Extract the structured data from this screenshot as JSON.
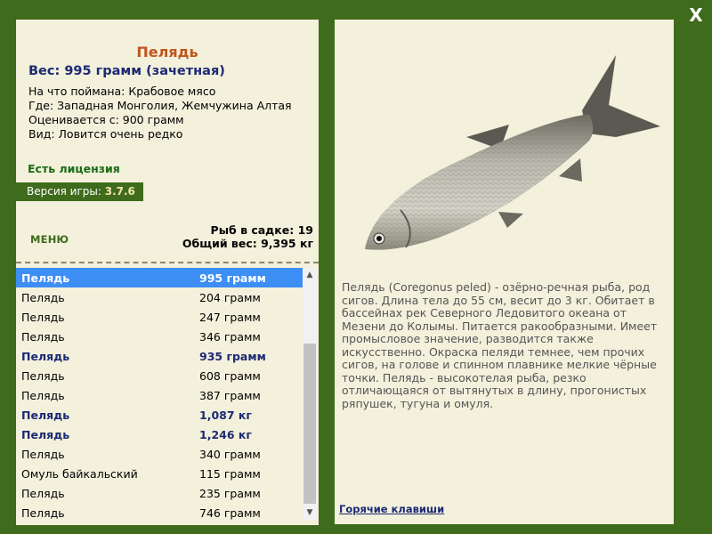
{
  "close_label": "X",
  "fish": {
    "title": "Пелядь",
    "weight": "Вес: 995 грамм (зачетная)",
    "bait": "На что поймана: Крабовое мясо",
    "place": "Где: Западная Монголия, Жемчужина Алтая",
    "value": "Оценивается с: 900 грамм",
    "rarity": "Вид: Ловится очень редко"
  },
  "license": "Есть лицензия",
  "version_label": "Версия игры:",
  "version_value": "3.7.6",
  "menu_label": "МЕНЮ",
  "stats": {
    "count": "Рыб в садке: 19",
    "total": "Общий вес: 9,395 кг"
  },
  "catch_list": [
    {
      "name": "Пелядь",
      "weight": "995 грамм",
      "style": "sel"
    },
    {
      "name": "Пелядь",
      "weight": "204 грамм",
      "style": ""
    },
    {
      "name": "Пелядь",
      "weight": "247 грамм",
      "style": ""
    },
    {
      "name": "Пелядь",
      "weight": "346 грамм",
      "style": ""
    },
    {
      "name": "Пелядь",
      "weight": "935 грамм",
      "style": "b"
    },
    {
      "name": "Пелядь",
      "weight": "608 грамм",
      "style": ""
    },
    {
      "name": "Пелядь",
      "weight": "387 грамм",
      "style": ""
    },
    {
      "name": "Пелядь",
      "weight": "1,087 кг",
      "style": "b"
    },
    {
      "name": "Пелядь",
      "weight": "1,246 кг",
      "style": "b"
    },
    {
      "name": "Пелядь",
      "weight": "340 грамм",
      "style": ""
    },
    {
      "name": "Омуль байкальский",
      "weight": "115 грамм",
      "style": ""
    },
    {
      "name": "Пелядь",
      "weight": "235 грамм",
      "style": ""
    },
    {
      "name": "Пелядь",
      "weight": "746 грамм",
      "style": ""
    }
  ],
  "description": "Пелядь (Coregonus peled) - озёрно-речная рыба, род сигов. Длина тела до 55 см, весит до 3 кг. Обитает в бассейнах рек Северного Ледовитого океана от Мезени до Колымы. Питается ракообразными. Имеет промысловое значение, разводится также искусственно. Окраска пеляди темнее, чем прочих сигов, на голове и спинном плавнике мелкие чёрные точки. Пелядь - высокотелая рыба, резко отличающаяся от вытянутых в длину, прогонистых ряпушек, тугуна и омуля.",
  "hotkeys_label": "Горячие клавиши",
  "colors": {
    "background": "#3f6b1c",
    "panel": "#f3f0dc",
    "selected_row": "#3d8ef5",
    "title": "#c0561e",
    "bold_weight": "#1c2a74"
  }
}
